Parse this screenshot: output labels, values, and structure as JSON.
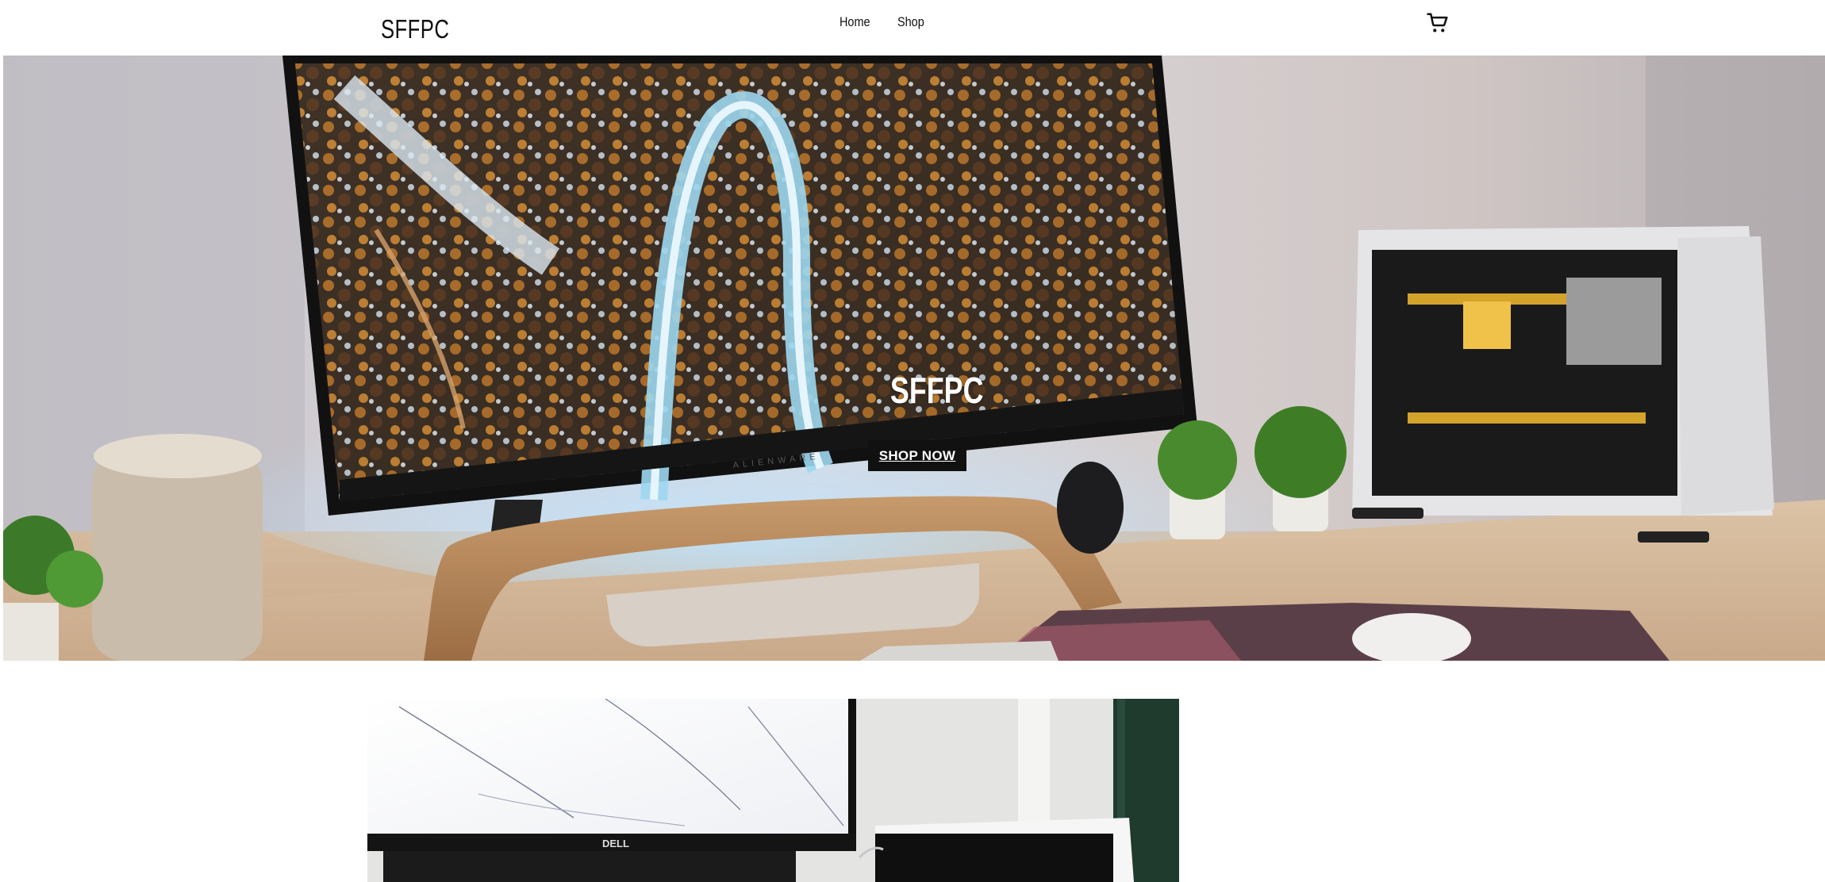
{
  "header": {
    "brand": "SFFPC",
    "nav": [
      {
        "label": "Home"
      },
      {
        "label": "Shop"
      }
    ],
    "cart_icon": "shopping-cart-icon"
  },
  "hero": {
    "title": "SFFPC",
    "button_label": "SHOP NOW",
    "monitor_brand": "ALIENWARE"
  },
  "feature": {
    "monitor_brand": "DELL"
  },
  "colors": {
    "text": "#111111",
    "button_bg": "#111111",
    "button_text": "#ffffff",
    "page_bg": "#ffffff"
  }
}
